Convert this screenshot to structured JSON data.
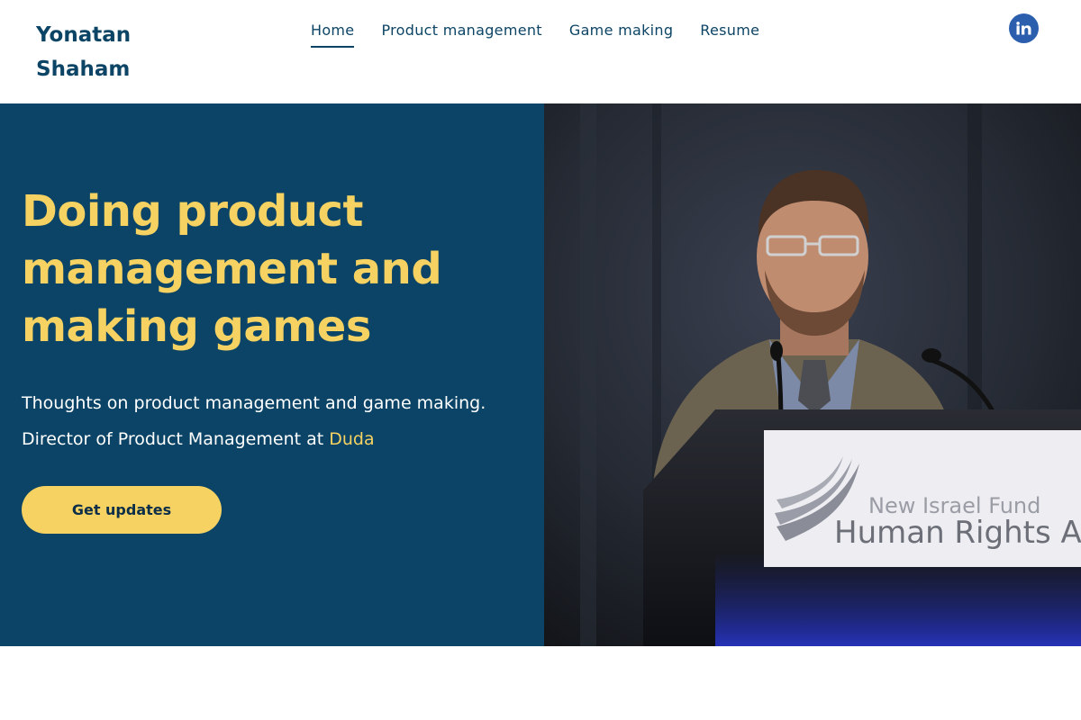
{
  "header": {
    "brand": "Yonatan Shaham",
    "nav": [
      {
        "label": "Home",
        "active": true
      },
      {
        "label": "Product management",
        "active": false
      },
      {
        "label": "Game making",
        "active": false
      },
      {
        "label": "Resume",
        "active": false
      }
    ],
    "social": {
      "label": "in",
      "icon": "linkedin-icon"
    }
  },
  "hero": {
    "title": "Doing product management and making games",
    "subtitle_line1": "Thoughts on product management and game making.",
    "subtitle_line2_prefix": "Director of Product Management at ",
    "subtitle_link": "Duda",
    "cta": "Get updates",
    "photo": {
      "sign_line1": "New Israel Fund",
      "sign_line2": "Human Rights Aw"
    }
  },
  "colors": {
    "brand_navy": "#0b4466",
    "accent_yellow": "#f5d261",
    "linkedin_blue": "#2b5fad"
  }
}
